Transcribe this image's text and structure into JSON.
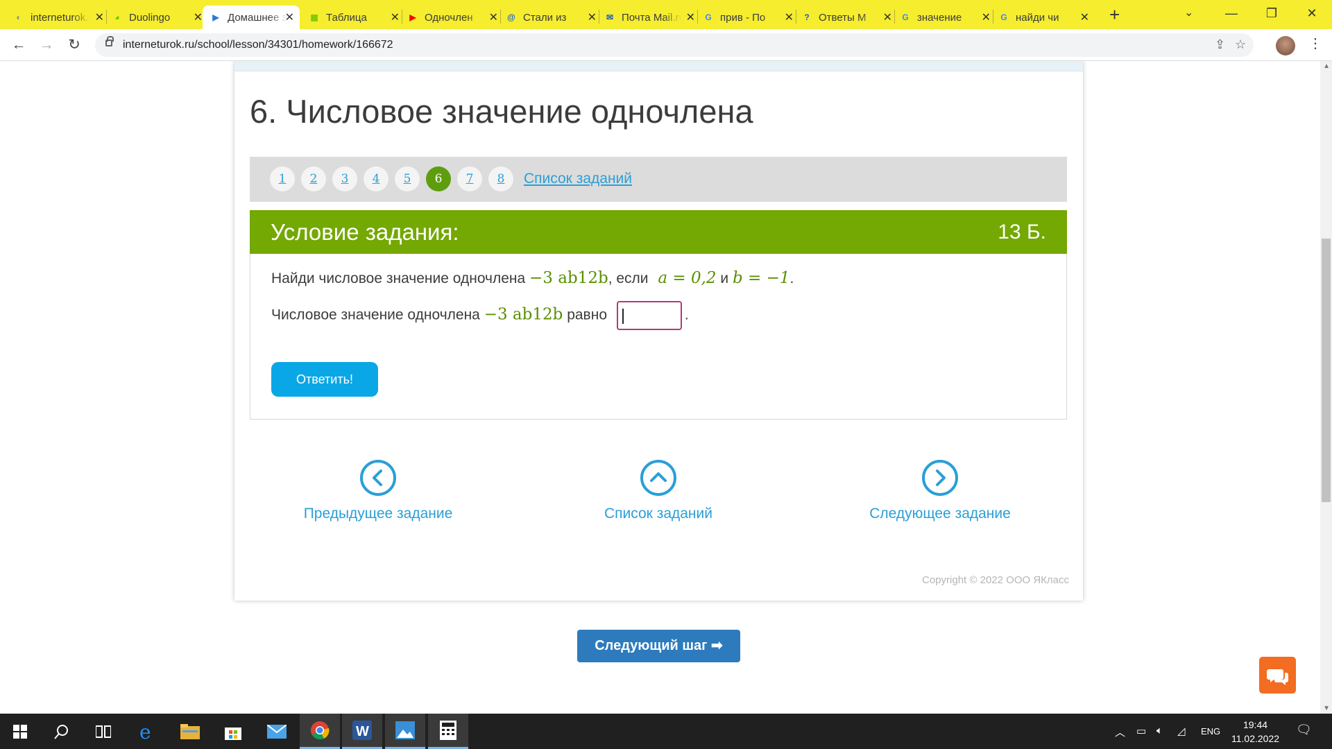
{
  "browser": {
    "tabs": [
      {
        "title": "interneturok.ru",
        "icon": "interneturok-favicon",
        "color": "#8a8a8a"
      },
      {
        "title": "Duolingo",
        "icon": "duolingo-favicon",
        "color": "#58cc02"
      },
      {
        "title": "Домашнее задание",
        "icon": "interneturok-play-favicon",
        "color": "#2a7ad8"
      },
      {
        "title": "Таблица",
        "icon": "sheet-favicon",
        "color": "#78c800"
      },
      {
        "title": "Одночлен",
        "icon": "youtube-favicon",
        "color": "#ff0000"
      },
      {
        "title": "Стали из",
        "icon": "mail-at-favicon",
        "color": "#1e5ec8"
      },
      {
        "title": "Почта Mail.ru",
        "icon": "mail-favicon",
        "color": "#1e5ec8"
      },
      {
        "title": "прив - По",
        "icon": "google-favicon",
        "color": "#4285f4"
      },
      {
        "title": "Ответы М",
        "icon": "question-favicon",
        "color": "#1e5ec8"
      },
      {
        "title": "значение",
        "icon": "google-favicon",
        "color": "#4285f4"
      },
      {
        "title": "найди чи",
        "icon": "google-favicon",
        "color": "#4285f4"
      }
    ],
    "active_tab": 2,
    "url": "interneturok.ru/school/lesson/34301/homework/166672"
  },
  "page": {
    "title": "6. Числовое значение одночлена",
    "task_numbers": [
      "1",
      "2",
      "3",
      "4",
      "5",
      "6",
      "7",
      "8"
    ],
    "current_task": 6,
    "task_list_link": "Список заданий",
    "condition_header": "Условие задания:",
    "points": "13 Б.",
    "line1": {
      "prefix": "Найди числовое значение одночлена",
      "monomial": "−3 ab12b",
      "middle": ", если",
      "cond_a": "a = 0,2",
      "and": "и",
      "cond_b": "b = −1",
      "end": "."
    },
    "line2": {
      "prefix": "Числовое значение одночлена",
      "monomial": "−3 ab12b",
      "suffix": "равно",
      "answer_value": "",
      "end": "."
    },
    "submit_label": "Ответить!",
    "nav": {
      "prev": "Предыдущее задание",
      "list": "Список заданий",
      "next": "Следующее задание"
    },
    "copyright": "Copyright © 2022 ООО ЯКласс",
    "next_step": "Следующий шаг ➡"
  },
  "taskbar": {
    "language": "ENG",
    "time": "19:44",
    "date": "11.02.2022"
  },
  "colors": {
    "accent_green": "#74a802",
    "link_blue": "#2a9fd6",
    "button_blue": "#0aa7e6",
    "next_step_blue": "#2d7bbd",
    "chat_orange": "#f26c21"
  }
}
